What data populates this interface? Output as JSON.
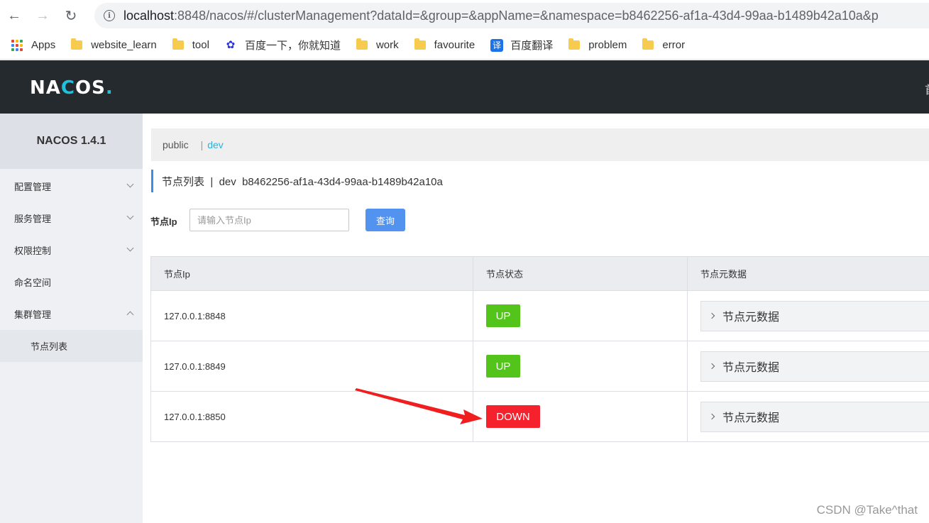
{
  "browser": {
    "back_icon": "←",
    "forward_icon": "→",
    "reload_icon": "↻",
    "url_host": "localhost",
    "url_rest": ":8848/nacos/#/clusterManagement?dataId=&group=&appName=&namespace=b8462256-af1a-43d4-99aa-b1489b42a10a&p",
    "bookmarks": [
      {
        "label": "Apps",
        "icon": "apps-grid-icon"
      },
      {
        "label": "website_learn",
        "icon": "folder-icon"
      },
      {
        "label": "tool",
        "icon": "folder-icon"
      },
      {
        "label": "百度一下，你就知道",
        "icon": "baidu-paw-icon"
      },
      {
        "label": "work",
        "icon": "folder-icon"
      },
      {
        "label": "favourite",
        "icon": "folder-icon"
      },
      {
        "label": "百度翻译",
        "icon": "baidu-translate-icon",
        "glyph": "译"
      },
      {
        "label": "problem",
        "icon": "folder-icon"
      },
      {
        "label": "error",
        "icon": "folder-icon"
      }
    ]
  },
  "header": {
    "logo_pre": "NA",
    "logo_accent": "C",
    "logo_post": "OS",
    "logo_dot": ".",
    "right_text": "首"
  },
  "sidebar": {
    "title": "NACOS 1.4.1",
    "items": [
      {
        "label": "配置管理",
        "expanded": false
      },
      {
        "label": "服务管理",
        "expanded": false
      },
      {
        "label": "权限控制",
        "expanded": false
      },
      {
        "label": "命名空间"
      },
      {
        "label": "集群管理",
        "expanded": true
      }
    ],
    "submenu": [
      "节点列表"
    ]
  },
  "main": {
    "namespaces": {
      "public": "public",
      "sep": "|",
      "dev": "dev"
    },
    "heading": "节点列表  |  dev  b8462256-af1a-43d4-99aa-b1489b42a10a",
    "search": {
      "label": "节点Ip",
      "placeholder": "请输入节点Ip",
      "button": "查询"
    },
    "table": {
      "headers": [
        "节点Ip",
        "节点状态",
        "节点元数据"
      ],
      "rows": [
        {
          "ip": "127.0.0.1:8848",
          "state": "UP",
          "meta": "节点元数据"
        },
        {
          "ip": "127.0.0.1:8849",
          "state": "UP",
          "meta": "节点元数据"
        },
        {
          "ip": "127.0.0.1:8850",
          "state": "DOWN",
          "meta": "节点元数据"
        }
      ]
    }
  },
  "colors": {
    "up": "#52c41a",
    "down": "#f5222d",
    "header_bg": "#252a2f",
    "accent": "#1ec2dc",
    "primary_button": "#5393f0"
  },
  "watermark": "CSDN @Take^that"
}
